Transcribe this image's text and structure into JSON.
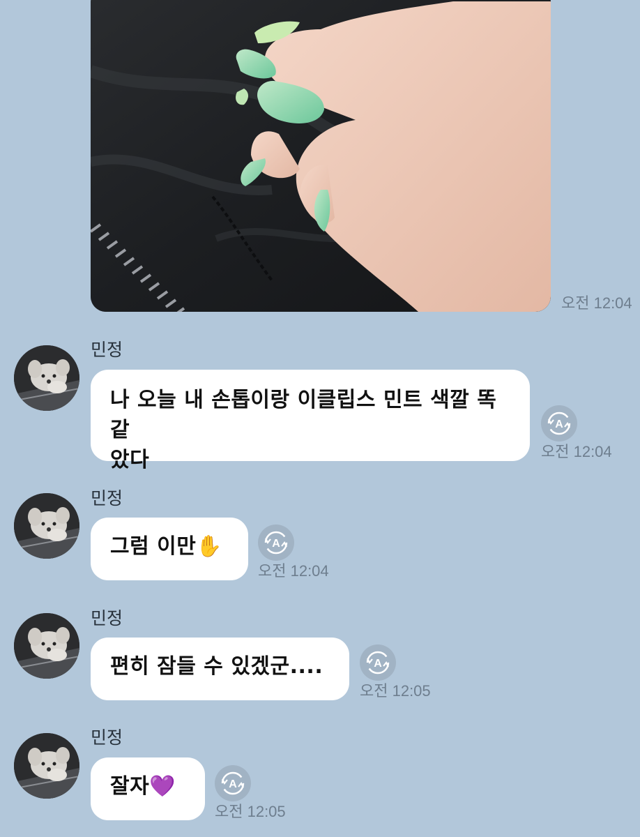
{
  "photo_message": {
    "time": "오전 12:04",
    "image": "photo-hand-mint-nails"
  },
  "messages": [
    {
      "sender": "민정",
      "text_line1": "나 오늘 내 손톱이랑 이클립스 민트 색깔 똑같",
      "text_line2": "았다",
      "time": "오전 12:04",
      "avatar": "avatar-puppy",
      "action_icon": "translate-icon"
    },
    {
      "sender": "민정",
      "text": "그럼 이만",
      "emoji": "✋",
      "time": "오전 12:04",
      "avatar": "avatar-puppy",
      "action_icon": "translate-icon"
    },
    {
      "sender": "민정",
      "text": "편히 잠들 수 있겠군....",
      "time": "오전 12:05",
      "avatar": "avatar-puppy",
      "action_icon": "translate-icon"
    },
    {
      "sender": "민정",
      "text": "잘자",
      "emoji": "💜",
      "time": "오전 12:05",
      "avatar": "avatar-puppy",
      "action_icon": "translate-icon"
    }
  ],
  "colors": {
    "chat_background": "#b2c7da",
    "bubble": "#ffffff",
    "timestamp": "#6e7e8e",
    "translate_button": "#a1b3c4"
  }
}
